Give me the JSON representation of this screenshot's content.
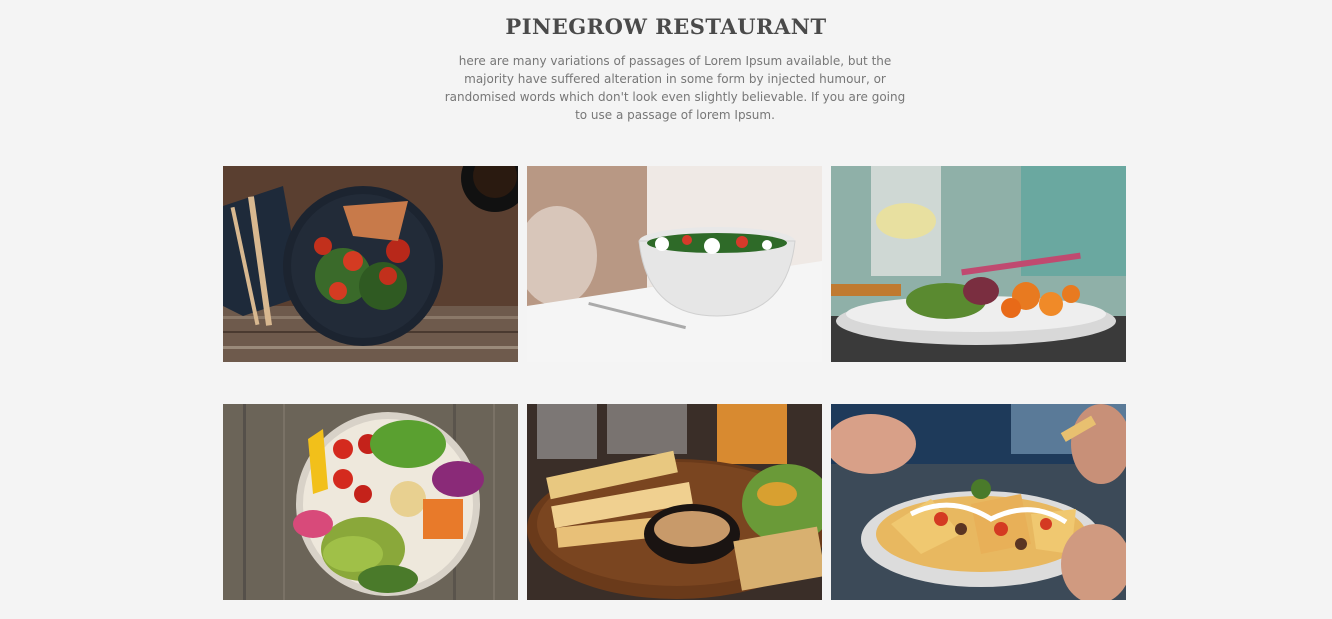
{
  "header": {
    "title": "PINEGROW RESTAURANT",
    "description": "here are many variations of passages of Lorem Ipsum available, but the majority have suffered alteration in some form by injected humour, or randomised words which don't look even slightly believable. If you are going to use a passage of lorem Ipsum."
  },
  "gallery": {
    "items": [
      {
        "name": "salad-plate-with-cutlery"
      },
      {
        "name": "salad-bowl-on-table"
      },
      {
        "name": "fried-dish-plate"
      },
      {
        "name": "buddha-bowl"
      },
      {
        "name": "grilled-plate-with-dip"
      },
      {
        "name": "nachos-plate"
      }
    ]
  },
  "colors": {
    "background": "#f4f4f4",
    "title": "#4a4a4a",
    "text": "#777777"
  }
}
